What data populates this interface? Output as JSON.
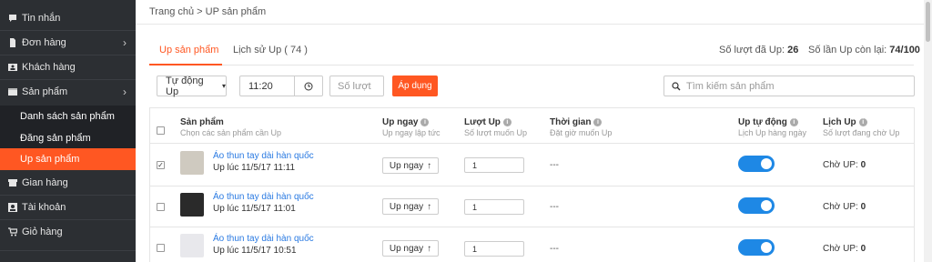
{
  "sidebar": {
    "items": [
      {
        "label": "Tin nhắn",
        "icon": "chat-icon"
      },
      {
        "label": "Đơn hàng",
        "icon": "document-icon",
        "has_chevron": true
      },
      {
        "label": "Khách hàng",
        "icon": "contact-card-icon"
      },
      {
        "label": "Sản phẩm",
        "icon": "box-icon",
        "has_chevron": true
      },
      {
        "label": "Gian hàng",
        "icon": "store-icon"
      },
      {
        "label": "Tài khoản",
        "icon": "user-icon"
      },
      {
        "label": "Giỏ hàng",
        "icon": "cart-icon"
      }
    ],
    "sub_items": [
      "Danh sách sản phẩm",
      "Đăng sản phẩm",
      "Up sản phẩm"
    ],
    "active_sub": "Up sản phẩm",
    "accent_color": "#ff5722"
  },
  "breadcrumb": "Trang chủ > UP sản phẩm",
  "tabs": [
    {
      "label": "Up sản phẩm",
      "active": true
    },
    {
      "label": "Lịch sử Up ( 74 )",
      "active": false
    }
  ],
  "stats": {
    "used_label": "Số lượt đã Up:",
    "used_value": "26",
    "remaining_label": "Số lần Up còn lại:",
    "remaining_value": "74/100"
  },
  "controls": {
    "mode": "Tự động Up",
    "time": "11:20",
    "count_placeholder": "Số lượt",
    "apply": "Áp dụng",
    "search_placeholder": "Tìm kiếm sản phẩm"
  },
  "columns": [
    {
      "title": "Sản phẩm",
      "sub": "Chọn các sản phẩm cần Up",
      "info": false
    },
    {
      "title": "Up ngay",
      "sub": "Up ngay lập tức",
      "info": true
    },
    {
      "title": "Lượt Up",
      "sub": "Số lượt muốn Up",
      "info": true
    },
    {
      "title": "Thời gian",
      "sub": "Đặt giờ muốn Up",
      "info": true
    },
    {
      "title": "Up tự động",
      "sub": "Lịch Up hàng ngày",
      "info": true
    },
    {
      "title": "Lịch Up",
      "sub": "Số lượt đang chờ Up",
      "info": true
    }
  ],
  "rows": [
    {
      "checked": true,
      "name": "Áo thun tay dài hàn quốc",
      "up_time": "Up lúc 11/5/17 11:11",
      "up_now": "Up ngay",
      "qty": "1",
      "time": "---",
      "auto": true,
      "waiting_label": "Chờ UP:",
      "waiting_value": "0"
    },
    {
      "checked": false,
      "name": "Áo thun tay dài hàn quốc",
      "up_time": "Up lúc 11/5/17 11:01",
      "up_now": "Up ngay",
      "qty": "1",
      "time": "---",
      "auto": true,
      "waiting_label": "Chờ UP:",
      "waiting_value": "0"
    },
    {
      "checked": false,
      "name": "Áo thun tay dài hàn quốc",
      "up_time": "Up lúc 11/5/17 10:51",
      "up_now": "Up ngay",
      "qty": "1",
      "time": "---",
      "auto": true,
      "waiting_label": "Chờ UP:",
      "waiting_value": "0"
    }
  ]
}
